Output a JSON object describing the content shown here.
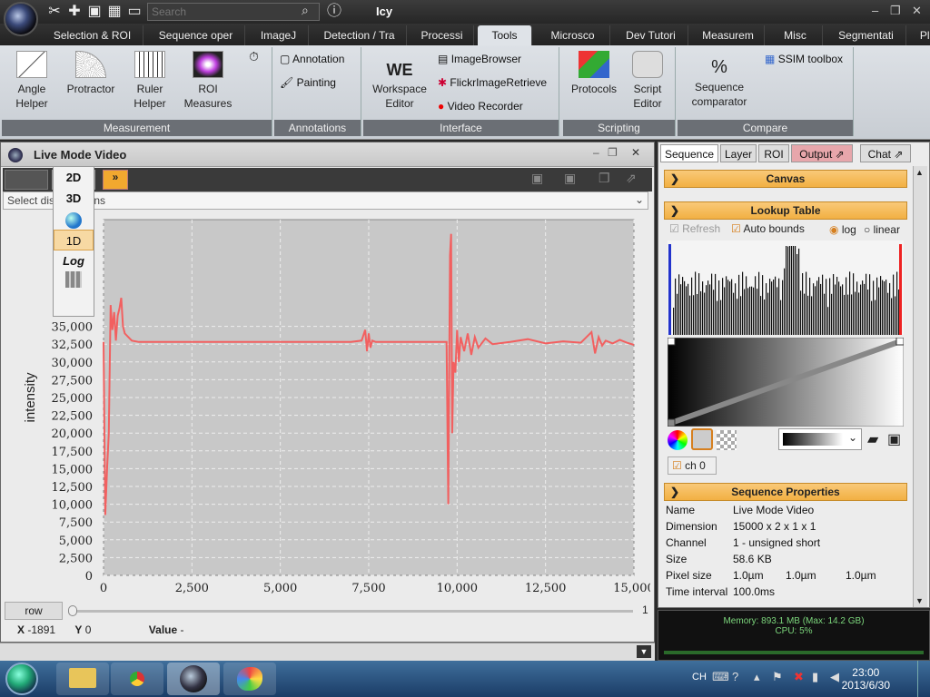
{
  "app": {
    "title": "Icy",
    "search_placeholder": "Search",
    "tabs": [
      {
        "label": "Selection & ROI",
        "active": false
      },
      {
        "label": "Sequence oper",
        "active": false
      },
      {
        "label": "ImageJ",
        "active": false
      },
      {
        "label": "Detection / Tra",
        "active": false
      },
      {
        "label": "Processi",
        "active": false
      },
      {
        "label": "Tools",
        "active": true
      },
      {
        "label": "Microsco",
        "active": false
      },
      {
        "label": "Dev Tutori",
        "active": false
      },
      {
        "label": "Measurem",
        "active": false
      },
      {
        "label": "Misc",
        "active": false
      },
      {
        "label": "Segmentati",
        "active": false
      },
      {
        "label": "Plugins",
        "active": false
      }
    ]
  },
  "ribbon": {
    "measurement": {
      "label": "Measurement",
      "buttons": [
        {
          "label": "Angle\nHelper",
          "icon": "angle-icon"
        },
        {
          "label": "Protractor",
          "icon": "protractor-icon"
        },
        {
          "label": "Ruler\nHelper",
          "icon": "ruler-icon"
        },
        {
          "label": "ROI\nMeasures",
          "icon": "roi-measures-icon"
        }
      ]
    },
    "annotations": {
      "label": "Annotations",
      "annotation": "Annotation",
      "painting": "Painting"
    },
    "interface": {
      "label": "Interface",
      "workspace": "Workspace\nEditor",
      "image_browser": "ImageBrowser",
      "flickr": "FlickrImageRetrieve",
      "video_recorder": "Video Recorder"
    },
    "scripting": {
      "label": "Scripting",
      "protocols": "Protocols",
      "script_editor": "Script\nEditor"
    },
    "compare": {
      "label": "Compare",
      "sequence_comparator": "Sequence\ncomparator",
      "ssim": "SSIM toolbox"
    }
  },
  "viewer": {
    "title": "Live Mode Video",
    "mode_selected": "1D",
    "select_bar": "Select disp         ons",
    "menu": [
      "2D",
      "3D",
      "",
      "1D",
      "Log",
      ""
    ],
    "row_button": "row",
    "slider_max": "1",
    "status": {
      "x_label": "X",
      "x_value": "-1891",
      "y_label": "Y",
      "y_value": "0",
      "value_label": "Value",
      "value_value": "-"
    }
  },
  "chart_data": {
    "type": "line",
    "title": "",
    "xlabel": "",
    "ylabel": "intensity",
    "xlim": [
      0,
      15000
    ],
    "ylim": [
      0,
      50000
    ],
    "x_ticks": [
      "0",
      "2,500",
      "5,000",
      "7,500",
      "10,000",
      "12,500",
      "15,000"
    ],
    "y_ticks": [
      "0",
      "2,500",
      "5,000",
      "7,500",
      "10,000",
      "12,500",
      "15,000",
      "17,500",
      "20,000",
      "22,500",
      "25,000",
      "27,500",
      "30,000",
      "32,500",
      "35,000"
    ],
    "grid": true,
    "color": "#f26060",
    "x": [
      0,
      50,
      100,
      150,
      200,
      250,
      300,
      350,
      400,
      450,
      500,
      550,
      600,
      700,
      800,
      1000,
      2000,
      3000,
      4000,
      5000,
      6000,
      7000,
      7300,
      7400,
      7450,
      7500,
      7550,
      7600,
      7700,
      8000,
      9000,
      9700,
      9750,
      9800,
      9830,
      9860,
      9900,
      9950,
      10000,
      10050,
      10100,
      10200,
      10300,
      10400,
      10500,
      10600,
      10800,
      11000,
      11500,
      12000,
      12500,
      13000,
      13500,
      13800,
      13900,
      14000,
      14100,
      14200,
      14400,
      14600,
      14800,
      15000
    ],
    "y": [
      32800,
      8500,
      15000,
      20000,
      38000,
      34500,
      37000,
      33000,
      36500,
      37500,
      39000,
      35000,
      34000,
      33500,
      33000,
      32800,
      32800,
      32800,
      32800,
      32800,
      32800,
      32800,
      33000,
      34500,
      31500,
      34000,
      32000,
      33000,
      32800,
      32800,
      32800,
      32800,
      10000,
      45000,
      48000,
      20000,
      30000,
      28500,
      34500,
      30000,
      33500,
      31500,
      34000,
      31000,
      33500,
      32000,
      33300,
      32500,
      32800,
      33200,
      32600,
      32900,
      32700,
      34200,
      31200,
      33500,
      32300,
      33000,
      32600,
      33100,
      32700,
      32400
    ]
  },
  "right_panel": {
    "tabs": [
      "Sequence",
      "Layer",
      "ROI",
      "Output",
      "Chat"
    ],
    "canvas_label": "Canvas",
    "lookup_label": "Lookup Table",
    "refresh": "Refresh",
    "auto_bounds": "Auto bounds",
    "log": "log",
    "linear": "linear",
    "channel": "ch 0",
    "seqprops_label": "Sequence Properties",
    "props": [
      {
        "k": "Name",
        "v": "Live Mode Video"
      },
      {
        "k": "Dimension",
        "v": "15000 x 2 x 1 x 1"
      },
      {
        "k": "Channel",
        "v": "1 - unsigned short"
      },
      {
        "k": "Size",
        "v": "58.6 KB"
      },
      {
        "k": "Pixel size",
        "v": "1.0µm"
      },
      {
        "k": "Time interval",
        "v": "100.0ms"
      }
    ],
    "pixel_size_extra": [
      "1.0µm",
      "1.0µm"
    ]
  },
  "memory": {
    "line1": "Memory: 893.1 MB  (Max: 14.2 GB)",
    "line2": "CPU: 5%"
  },
  "taskbar": {
    "lang": "CH",
    "time": "23:00",
    "date": "2013/6/30"
  }
}
